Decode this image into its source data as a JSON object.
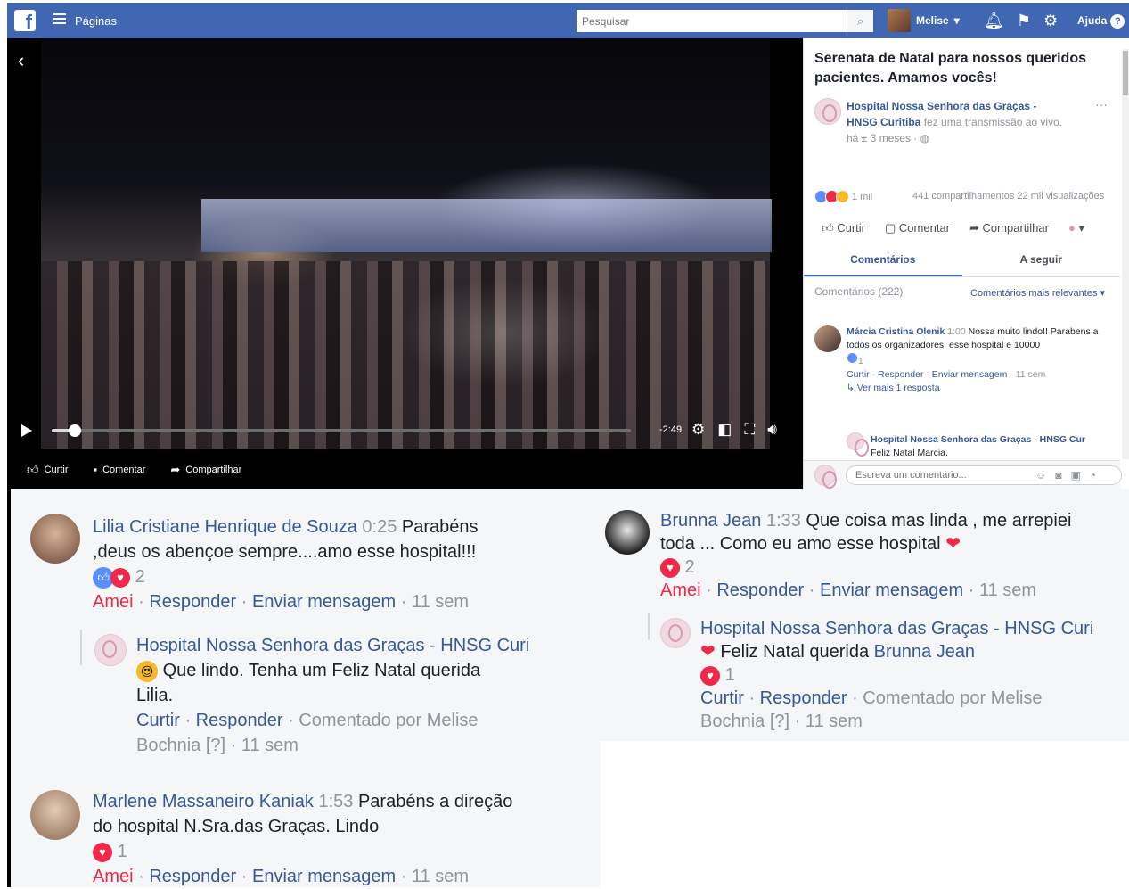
{
  "topbar": {
    "pages_label": "Páginas",
    "search_placeholder": "Pesquisar",
    "user_name": "Melise",
    "help_label": "Ajuda"
  },
  "video": {
    "time": "-2:49",
    "progress_fraction": 0.04,
    "actions": {
      "like": "Curtir",
      "comment": "Comentar",
      "share": "Compartilhar"
    }
  },
  "post": {
    "title": "Serenata de Natal para nossos queridos pacientes. Amamos vocês!",
    "author": "Hospital Nossa Senhora das Graças - HNSG Curitiba",
    "author_action": "fez uma transmissão ao vivo.",
    "time": "há ± 3 meses ·",
    "reactions_count": "1 mil",
    "shares": "441 compartilhamentos",
    "views": "22 mil visualizações",
    "actions": {
      "like": "Curtir",
      "comment": "Comentar",
      "share": "Compartilhar"
    },
    "tabs": {
      "comments": "Comentários",
      "follow": "A seguir"
    },
    "comments_count": "Comentários (222)",
    "relevant": "Comentários mais relevantes ▾",
    "comment": {
      "name": "Márcia Cristina Olenik",
      "stamp": "1:00",
      "text": "Nossa muito lindo!! Parabens a todos os organizadores, esse hospital e 10000",
      "like_count": "1",
      "links": [
        "Curtir",
        "Responder",
        "Enviar mensagem"
      ],
      "age": "11 sem",
      "more": "Ver mais 1 resposta"
    },
    "reply": {
      "name": "Hospital Nossa Senhora das Graças - HNSG Cur",
      "text": "Feliz Natal Marcia."
    },
    "write_placeholder": "Escreva um comentário..."
  },
  "comments": {
    "lilia": {
      "name": "Lilia Cristiane Henrique de Souza",
      "stamp": "0:25",
      "text1": "Parabéns",
      "text2": ",deus os abençoe sempre....amo esse hospital!!!",
      "count": "2",
      "links": [
        "Amei",
        "Responder",
        "Enviar mensagem"
      ],
      "age": "11 sem"
    },
    "lilia_reply": {
      "name": "Hospital Nossa Senhora das Graças - HNSG Curi",
      "text1": "Que lindo. Tenha um Feliz Natal querida",
      "text2": "Lilia.",
      "links": [
        "Curtir",
        "Responder"
      ],
      "by": "Comentado por Melise",
      "by2": "Bochnia [?]",
      "age": "11 sem"
    },
    "marlene": {
      "name": "Marlene Massaneiro Kaniak",
      "stamp": "1:53",
      "text1": "Parabéns a direção",
      "text2": "do hospital N.Sra.das Graças. Lindo",
      "count": "1",
      "links": [
        "Amei",
        "Responder",
        "Enviar mensagem"
      ],
      "age": "11 sem"
    },
    "brunna": {
      "name": "Brunna Jean",
      "stamp": "1:33",
      "text1": "Que coisa mas linda , me arrepiei",
      "text2": "toda ... Como eu amo esse hospital",
      "count": "2",
      "links": [
        "Amei",
        "Responder",
        "Enviar mensagem"
      ],
      "age": "11 sem"
    },
    "brunna_reply": {
      "name": "Hospital Nossa Senhora das Graças - HNSG Curi",
      "text": "Feliz Natal querida",
      "mention": "Brunna Jean",
      "count": "1",
      "links": [
        "Curtir",
        "Responder"
      ],
      "by": "Comentado por Melise",
      "by2": "Bochnia [?]",
      "age": "11 sem"
    }
  },
  "colors": {
    "brand": "#4267b2",
    "link": "#365899",
    "love": "#f0284a",
    "like": "#5890ff"
  }
}
